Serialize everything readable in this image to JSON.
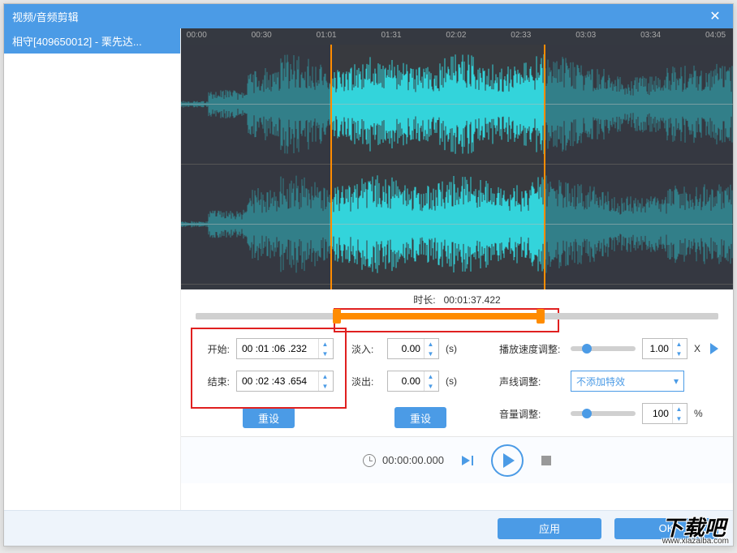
{
  "window": {
    "title": "视频/音频剪辑"
  },
  "sidebar": {
    "file_name": "相守[409650012] - 栗先达..."
  },
  "ruler": {
    "ticks": [
      "00:00",
      "00:30",
      "01:01",
      "01:31",
      "02:02",
      "02:33",
      "03:03",
      "03:34",
      "04:05"
    ]
  },
  "duration": {
    "label": "时长:",
    "value": "00:01:37.422"
  },
  "selection": {
    "start_pct": 27,
    "end_pct": 66
  },
  "trim": {
    "start_label": "开始:",
    "start_value": "00 :01 :06 .232",
    "end_label": "结束:",
    "end_value": "00 :02 :43 .654",
    "reset_label": "重设"
  },
  "fade": {
    "in_label": "淡入:",
    "in_value": "0.00",
    "out_label": "淡出:",
    "out_value": "0.00",
    "unit": "(s)",
    "reset_label": "重设"
  },
  "adjust": {
    "speed_label": "播放速度调整:",
    "speed_value": "1.00",
    "speed_suffix": "X",
    "speed_slider_pct": 18,
    "voice_label": "声线调整:",
    "voice_value": "不添加特效",
    "volume_label": "音量调整:",
    "volume_value": "100",
    "volume_suffix": "%",
    "volume_slider_pct": 18
  },
  "player": {
    "time": "00:00:00.000"
  },
  "footer": {
    "apply": "应用",
    "ok": "OK"
  },
  "watermark": {
    "main": "下载吧",
    "sub": "www.xiazaiba.com"
  }
}
